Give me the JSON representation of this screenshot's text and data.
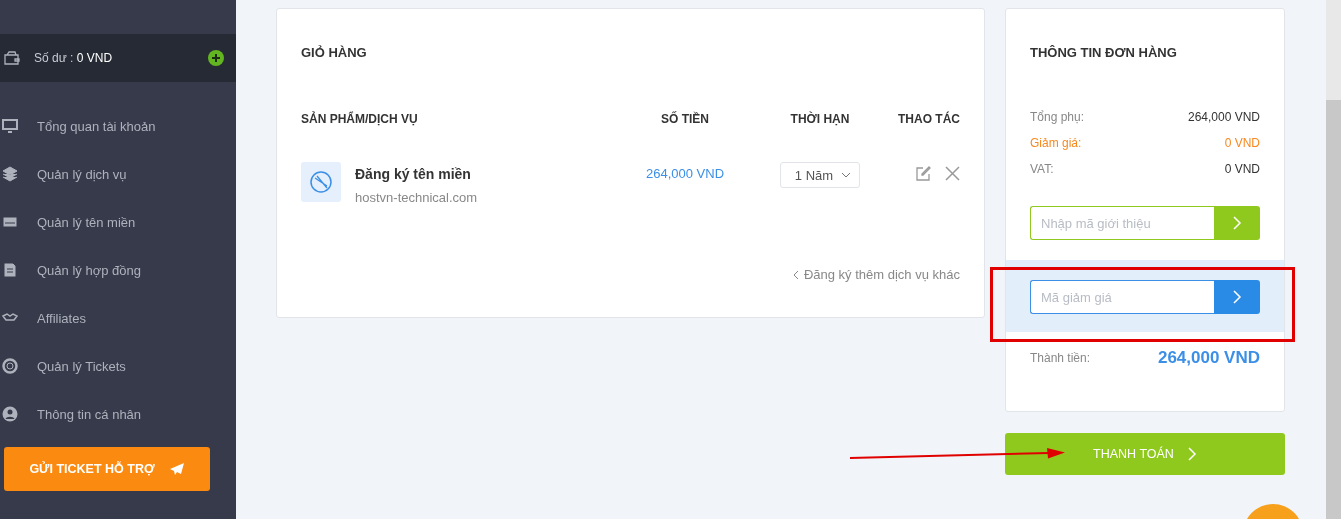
{
  "sidebar": {
    "balance": {
      "label": "Số dư :",
      "value": "0 VND"
    },
    "items": [
      "Tổng quan tài khoản",
      "Quản lý dịch vụ",
      "Quản lý tên miền",
      "Quản lý hợp đồng",
      "Affiliates",
      "Quản lý Tickets",
      "Thông tin cá nhân"
    ],
    "support_button": "GỬI TICKET HỖ TRỢ"
  },
  "cart": {
    "title": "GIỎ HÀNG",
    "columns": [
      "SẢN PHẨM/DỊCH VỤ",
      "SỐ TIỀN",
      "THỜI HẠN",
      "THAO TÁC"
    ],
    "rows": [
      {
        "name": "Đăng ký tên miền",
        "domain": "hostvn-technical.com",
        "price": "264,000 VND",
        "term": "1 Năm"
      }
    ],
    "more_link": "Đăng ký thêm dịch vụ khác"
  },
  "order": {
    "title": "THÔNG TIN ĐƠN HÀNG",
    "lines": [
      {
        "label": "Tổng phụ:",
        "value": "264,000 VND",
        "kind": "normal"
      },
      {
        "label": "Giảm giá:",
        "value": "0 VND",
        "kind": "discount"
      },
      {
        "label": "VAT:",
        "value": "0 VND",
        "kind": "normal"
      }
    ],
    "referral": {
      "placeholder": "Nhập mã giới thiệu"
    },
    "coupon": {
      "placeholder": "Mã giảm giá"
    },
    "total": {
      "label": "Thành tiền:",
      "value": "264,000 VND"
    },
    "pay_button": "THANH TOÁN"
  }
}
